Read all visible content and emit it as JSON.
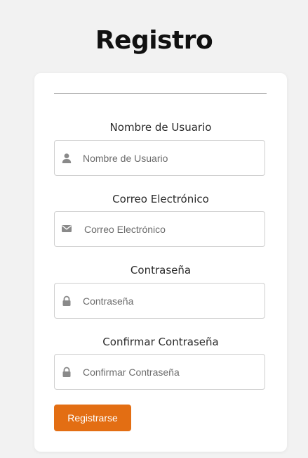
{
  "page": {
    "title": "Registro"
  },
  "form": {
    "fields": [
      {
        "label": "Nombre de Usuario",
        "placeholder": "Nombre de Usuario",
        "value": "",
        "icon": "user-icon",
        "type": "text"
      },
      {
        "label": "Correo Electrónico",
        "placeholder": "Correo Electrónico",
        "value": "",
        "icon": "envelope-icon",
        "type": "email"
      },
      {
        "label": "Contraseña",
        "placeholder": "Contraseña",
        "value": "",
        "icon": "lock-icon",
        "type": "password"
      },
      {
        "label": "Confirmar Contraseña",
        "placeholder": "Confirmar Contraseña",
        "value": "",
        "icon": "lock-icon",
        "type": "password"
      }
    ],
    "submit_label": "Registrarse"
  },
  "colors": {
    "background": "#f2f2f2",
    "card": "#ffffff",
    "accent": "#e36e13",
    "icon": "#8a8a8a"
  }
}
